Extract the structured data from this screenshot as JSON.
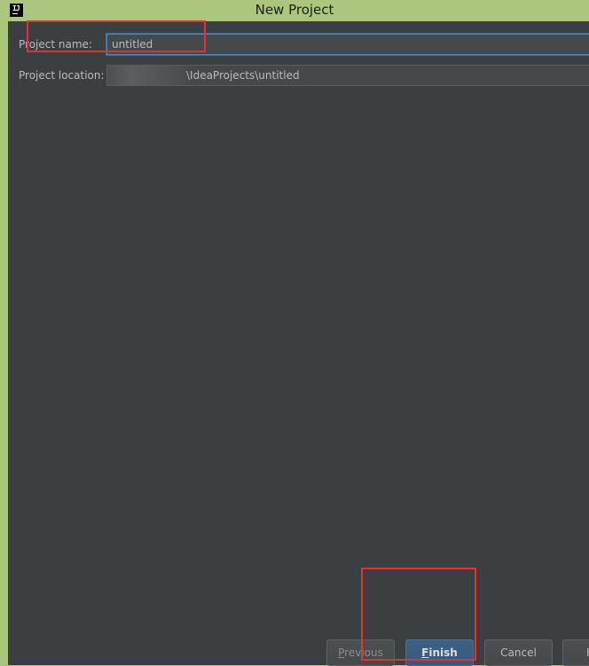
{
  "window": {
    "title": "New Project",
    "app_icon_text": "IJ"
  },
  "form": {
    "project_name_label": "Project name:",
    "project_name_value": "untitled",
    "project_location_label": "Project location:",
    "project_location_value": "\\IdeaProjects\\untitled"
  },
  "buttons": {
    "previous_first": "P",
    "previous_rest": "revious",
    "finish_first": "F",
    "finish_rest": "inish",
    "cancel": "Cancel",
    "help": "H"
  },
  "colors": {
    "background": "#3c3f41",
    "field_background": "#45494a",
    "focus_border": "#4a88c7",
    "finish_button": "#365880",
    "annotation": "#e8312f",
    "window_frame": "#a9c47b"
  }
}
